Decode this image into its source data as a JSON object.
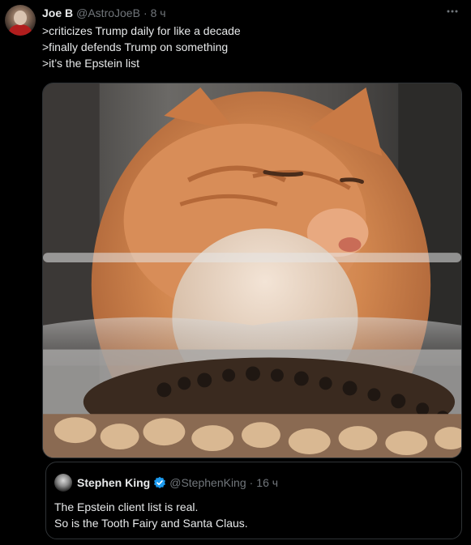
{
  "tweet": {
    "author_name": "Joe B",
    "author_handle": "@AstroJoeB",
    "separator": "·",
    "time": "8 ч",
    "more_icon": "more-horizontal-icon",
    "lines": [
      ">criticizes Trump daily for like a decade",
      ">finally defends Trump on something",
      ">it’s the Epstein list"
    ]
  },
  "quote": {
    "author_name": "Stephen King",
    "verified_icon": "verified-badge-icon",
    "verified_color": "#1d9bf0",
    "author_handle": "@StephenKing",
    "separator": "·",
    "time": "16 ч",
    "lines": [
      "The Epstein client list is real.",
      "So is the Tooth Fairy and Santa Claus."
    ]
  }
}
